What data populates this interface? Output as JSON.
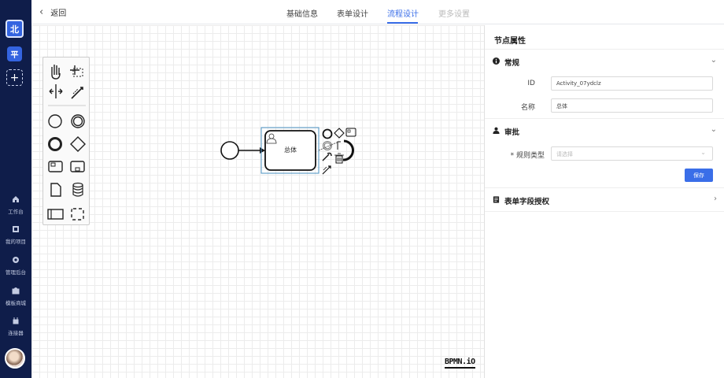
{
  "sidebar": {
    "workspace_primary": "北",
    "workspace_secondary": "平",
    "add_label": "+",
    "nav": [
      {
        "label": "工作台",
        "icon": "home-icon"
      },
      {
        "label": "我的项目",
        "icon": "project-icon"
      },
      {
        "label": "管理后台",
        "icon": "settings-icon"
      },
      {
        "label": "模板商城",
        "icon": "shop-icon"
      },
      {
        "label": "连接器",
        "icon": "plugin-icon"
      }
    ]
  },
  "header": {
    "back_label": "返回",
    "tabs": [
      {
        "label": "基础信息",
        "state": "normal"
      },
      {
        "label": "表单设计",
        "state": "normal"
      },
      {
        "label": "流程设计",
        "state": "active"
      },
      {
        "label": "更多设置",
        "state": "disabled"
      }
    ]
  },
  "canvas": {
    "task_label": "总体",
    "watermark": "BPMN.iO"
  },
  "panel": {
    "title": "节点属性",
    "general": {
      "title": "常规",
      "id_label": "ID",
      "id_value": "Activity_07ydclz",
      "name_label": "名称",
      "name_value": "总体"
    },
    "approval": {
      "title": "审批",
      "rule_label": "* 规则类型",
      "rule_placeholder": "请选择",
      "save_label": "保存"
    },
    "form_auth": {
      "title": "表单字段授权"
    }
  },
  "colors": {
    "sidebar_bg": "#0f1d4a",
    "accent": "#3a6ee8",
    "selection": "#4a90c2"
  }
}
